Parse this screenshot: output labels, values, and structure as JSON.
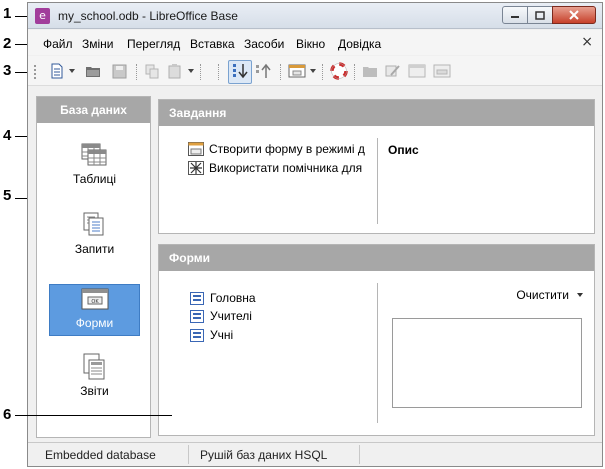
{
  "callouts": [
    "1",
    "2",
    "3",
    "4",
    "5",
    "6"
  ],
  "window": {
    "title": "my_school.odb - LibreOffice Base",
    "app_icon_glyph": "e"
  },
  "menu": {
    "items": [
      "Файл",
      "Зміни",
      "Перегляд",
      "Вставка",
      "Засоби",
      "Вікно",
      "Довідка"
    ],
    "close_glyph": "×"
  },
  "toolbar": {
    "icons": [
      "new-document-icon",
      "open-folder-icon",
      "save-icon",
      "copy-icon",
      "paste-icon",
      "sort-descending-icon",
      "sort-ascending-icon",
      "form-icon",
      "help-lifebuoy-icon",
      "open-db-object-icon",
      "edit-icon",
      "delete-icon",
      "rename-icon"
    ]
  },
  "left_panel": {
    "title": "База даних",
    "items": [
      {
        "label": "Таблиці",
        "icon": "tables-icon",
        "selected": false
      },
      {
        "label": "Запити",
        "icon": "queries-icon",
        "selected": false
      },
      {
        "label": "Форми",
        "icon": "forms-icon",
        "selected": true
      },
      {
        "label": "Звіти",
        "icon": "reports-icon",
        "selected": false
      }
    ]
  },
  "tasks_panel": {
    "title": "Завдання",
    "tasks": [
      "Створити форму в режимі д",
      "Використати помічника для"
    ],
    "description_title": "Опис"
  },
  "forms_panel": {
    "title": "Форми",
    "items": [
      "Головна",
      "Учителі",
      "Учні"
    ],
    "preview_select": "Очистити"
  },
  "statusbar": {
    "left": "Embedded database",
    "middle": "Рушій баз даних HSQL"
  },
  "colors": {
    "panel_header": "#a7a7a7",
    "selected_nav": "#5d9be0",
    "close_button": "#c7402a"
  }
}
